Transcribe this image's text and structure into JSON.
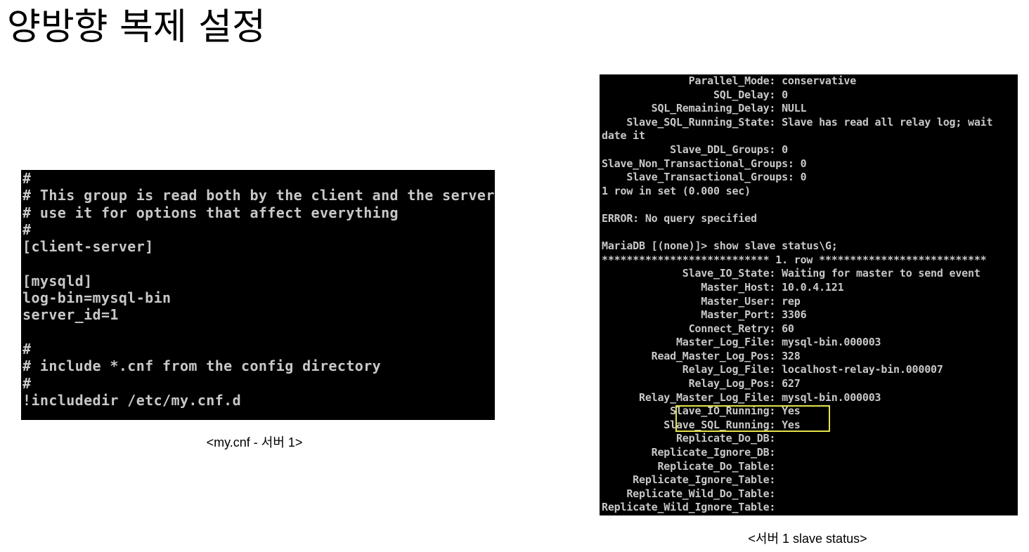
{
  "title": "양방향 복제 설정",
  "terminal_mycnf": {
    "lines": [
      "#",
      "# This group is read both by the client and the server",
      "# use it for options that affect everything",
      "#",
      "[client-server]",
      "",
      "[mysqld]",
      "log-bin=mysql-bin",
      "server_id=1",
      "",
      "#",
      "# include *.cnf from the config directory",
      "#",
      "!includedir /etc/my.cnf.d"
    ],
    "text_color": "#c8c8c8",
    "background": "#000000"
  },
  "caption_mycnf": "<my.cnf - 서버 1>",
  "terminal_slave_status": {
    "lines": [
      "              Parallel_Mode: conservative",
      "                  SQL_Delay: 0",
      "        SQL_Remaining_Delay: NULL",
      "    Slave_SQL_Running_State: Slave has read all relay log; wait",
      "date it",
      "           Slave_DDL_Groups: 0",
      "Slave_Non_Transactional_Groups: 0",
      "    Slave_Transactional_Groups: 0",
      "1 row in set (0.000 sec)",
      "",
      "ERROR: No query specified",
      "",
      "MariaDB [(none)]> show slave status\\G;",
      "*************************** 1. row ***************************",
      "             Slave_IO_State: Waiting for master to send event",
      "                Master_Host: 10.0.4.121",
      "                Master_User: rep",
      "                Master_Port: 3306",
      "              Connect_Retry: 60",
      "            Master_Log_File: mysql-bin.000003",
      "        Read_Master_Log_Pos: 328",
      "             Relay_Log_File: localhost-relay-bin.000007",
      "              Relay_Log_Pos: 627",
      "      Relay_Master_Log_File: mysql-bin.000003",
      "           Slave_IO_Running: Yes",
      "          Slave_SQL_Running: Yes",
      "            Replicate_Do_DB: ",
      "        Replicate_Ignore_DB: ",
      "         Replicate_Do_Table: ",
      "     Replicate_Ignore_Table: ",
      "    Replicate_Wild_Do_Table: ",
      "Replicate_Wild_Ignore_Table: "
    ],
    "highlight_color": "#e6e24a",
    "highlighted_fields": [
      "Slave_IO_Running: Yes",
      "Slave_SQL_Running: Yes"
    ]
  },
  "caption_slave_status": "<서버 1 slave status>"
}
